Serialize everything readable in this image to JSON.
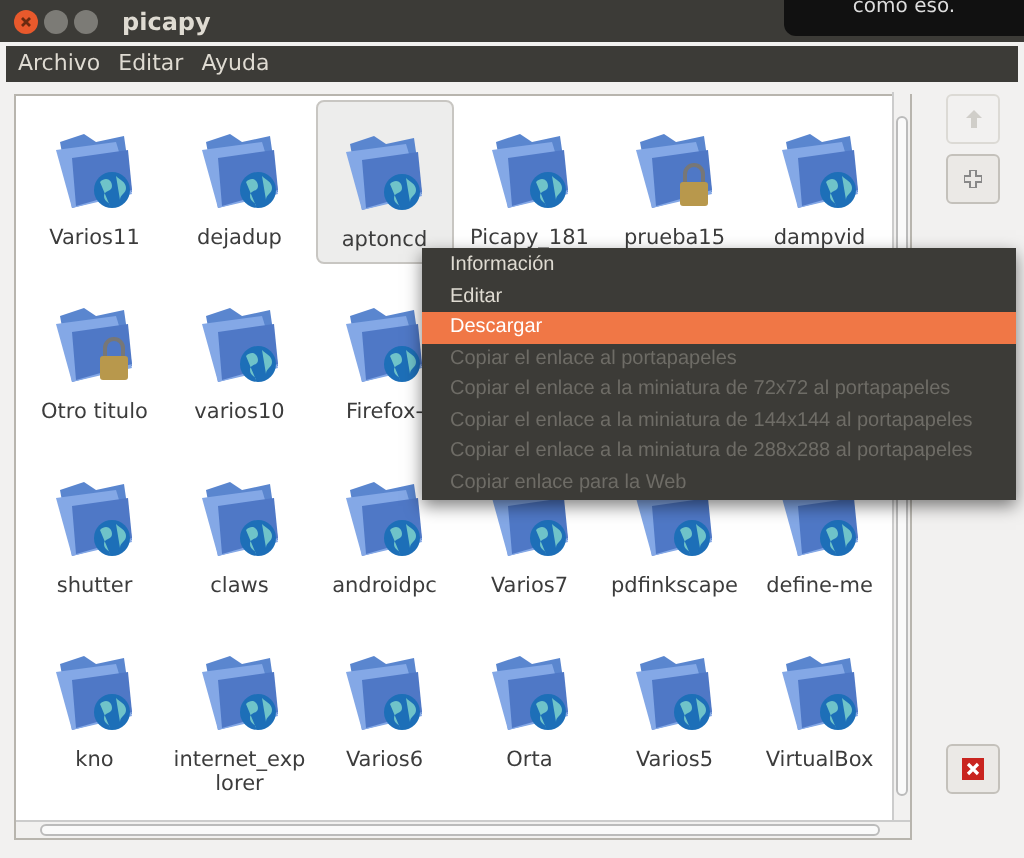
{
  "window": {
    "title": "picapy"
  },
  "notification": {
    "text": "como eso."
  },
  "menubar": [
    "Archivo",
    "Editar",
    "Ayuda"
  ],
  "rows": [
    [
      {
        "label": "Varios11",
        "kind": "globe",
        "selected": false
      },
      {
        "label": "dejadup",
        "kind": "globe",
        "selected": false
      },
      {
        "label": "aptoncd",
        "kind": "globe",
        "selected": true
      },
      {
        "label": "Picapy_181",
        "kind": "globe",
        "selected": false
      },
      {
        "label": "prueba15",
        "kind": "lock",
        "selected": false
      },
      {
        "label": "dampvid",
        "kind": "globe",
        "selected": false
      }
    ],
    [
      {
        "label": "Otro titulo",
        "kind": "lock",
        "selected": false
      },
      {
        "label": "varios10",
        "kind": "globe",
        "selected": false
      },
      {
        "label": "Firefox-",
        "kind": "globe",
        "selected": false
      }
    ],
    [
      {
        "label": "shutter",
        "kind": "globe",
        "selected": false
      },
      {
        "label": "claws",
        "kind": "globe",
        "selected": false
      },
      {
        "label": "androidpc",
        "kind": "globe",
        "selected": false
      },
      {
        "label": "Varios7",
        "kind": "globe",
        "selected": false
      },
      {
        "label": "pdfinkscape",
        "kind": "globe",
        "selected": false
      },
      {
        "label": "define-me",
        "kind": "globe",
        "selected": false
      }
    ],
    [
      {
        "label": "kno",
        "kind": "globe",
        "selected": false
      },
      {
        "label": "internet_exp lorer",
        "kind": "globe",
        "selected": false
      },
      {
        "label": "Varios6",
        "kind": "globe",
        "selected": false
      },
      {
        "label": "Orta",
        "kind": "globe",
        "selected": false
      },
      {
        "label": "Varios5",
        "kind": "globe",
        "selected": false
      },
      {
        "label": "VirtualBox",
        "kind": "globe",
        "selected": false
      }
    ]
  ],
  "side_buttons": [
    {
      "kind": "up",
      "disabled": true
    },
    {
      "kind": "add",
      "disabled": false
    },
    {
      "kind": "delete",
      "disabled": false
    }
  ],
  "context_menu": [
    {
      "label": "Información",
      "disabled": false,
      "selected": false
    },
    {
      "label": "Editar",
      "disabled": false,
      "selected": false
    },
    {
      "label": "Descargar",
      "disabled": false,
      "selected": true
    },
    {
      "label": "Copiar el enlace al portapapeles",
      "disabled": true,
      "selected": false
    },
    {
      "label": "Copiar el enlace a la miniatura de 72x72 al portapapeles",
      "disabled": true,
      "selected": false
    },
    {
      "label": "Copiar el enlace a la miniatura de 144x144 al portapapeles",
      "disabled": true,
      "selected": false
    },
    {
      "label": "Copiar el enlace a la miniatura de 288x288 al portapapeles",
      "disabled": true,
      "selected": false
    },
    {
      "label": "Copiar enlace para la Web",
      "disabled": true,
      "selected": false
    }
  ]
}
